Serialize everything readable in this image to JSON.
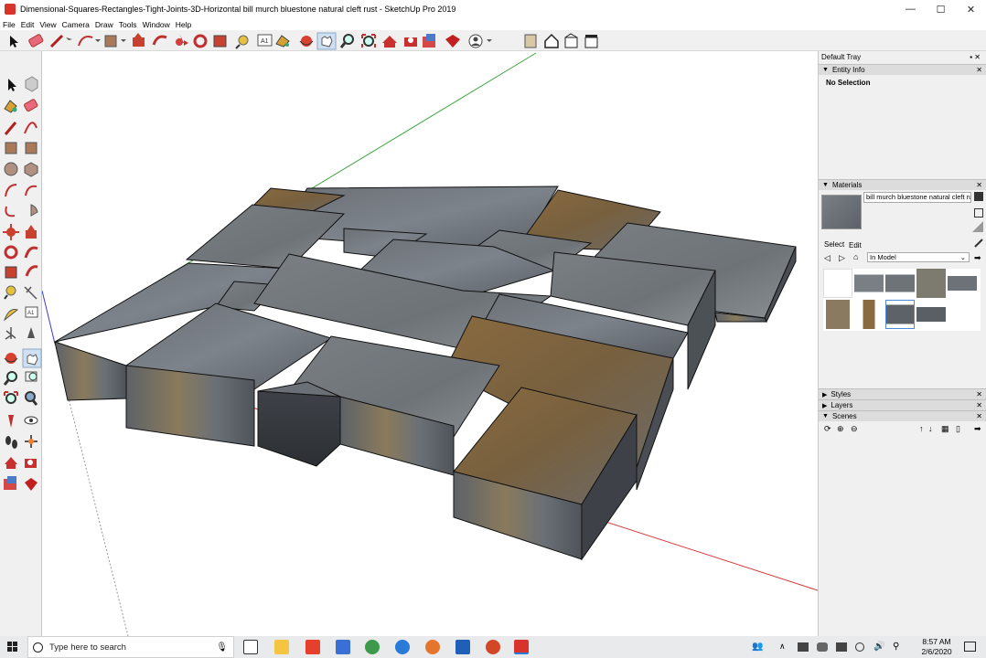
{
  "window": {
    "title": "Dimensional-Squares-Rectangles-Tight-Joints-3D-Horizontal bill murch bluestone natural cleft rust - SketchUp Pro 2019",
    "minimize_glyph": "—",
    "maximize_glyph": "☐",
    "close_glyph": "✕"
  },
  "menu": [
    "File",
    "Edit",
    "View",
    "Camera",
    "Draw",
    "Tools",
    "Window",
    "Help"
  ],
  "tray": {
    "title": "Default Tray",
    "entity_info": {
      "label": "Entity Info",
      "status": "No Selection"
    },
    "materials": {
      "label": "Materials",
      "material_name": "bill murch bluestone natural cleft ru",
      "tab_select": "Select",
      "tab_edit": "Edit",
      "collection": "In Model"
    },
    "styles_label": "Styles",
    "layers_label": "Layers",
    "scenes_label": "Scenes"
  },
  "taskbar": {
    "search_placeholder": "Type here to search",
    "time": "8:57 AM",
    "date": "2/6/2020"
  },
  "colors": {
    "accent_red": "#d9342b",
    "axis_green": "#3aa43a",
    "axis_red": "#d53a3a",
    "axis_blue": "#3a3ad5",
    "stone_grey": "#6d7278",
    "stone_rust": "#8a6a3f"
  }
}
